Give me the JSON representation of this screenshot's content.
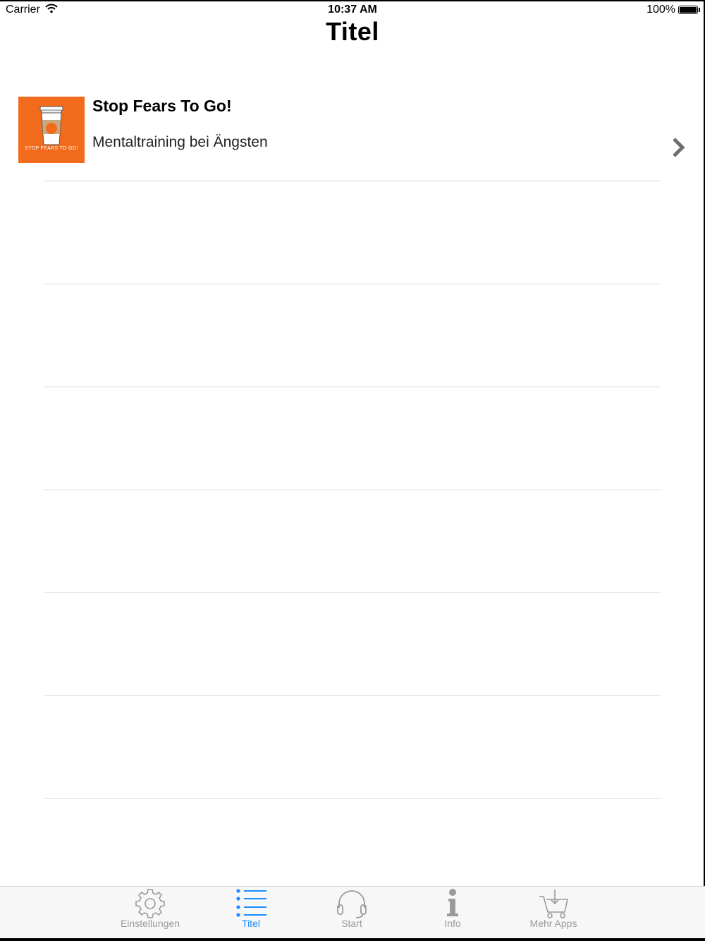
{
  "status_bar": {
    "carrier": "Carrier",
    "time": "10:37 AM",
    "battery": "100%"
  },
  "nav": {
    "title": "Titel"
  },
  "list": {
    "items": [
      {
        "title": "Stop Fears To Go!",
        "subtitle": "Mentaltraining bei Ängsten",
        "thumbnail_text": "STOP FEARS TO GO!"
      }
    ]
  },
  "tab_bar": {
    "tabs": [
      {
        "label": "Einstellungen",
        "icon": "gear-icon",
        "active": false
      },
      {
        "label": "Titel",
        "icon": "list-icon",
        "active": true
      },
      {
        "label": "Start",
        "icon": "headphones-icon",
        "active": false
      },
      {
        "label": "Info",
        "icon": "info-icon",
        "active": false
      },
      {
        "label": "Mehr Apps",
        "icon": "cart-icon",
        "active": false
      }
    ]
  },
  "colors": {
    "accent": "#1a8cff",
    "inactive": "#9a9a9a",
    "thumbnail_bg": "#f26a1b"
  }
}
